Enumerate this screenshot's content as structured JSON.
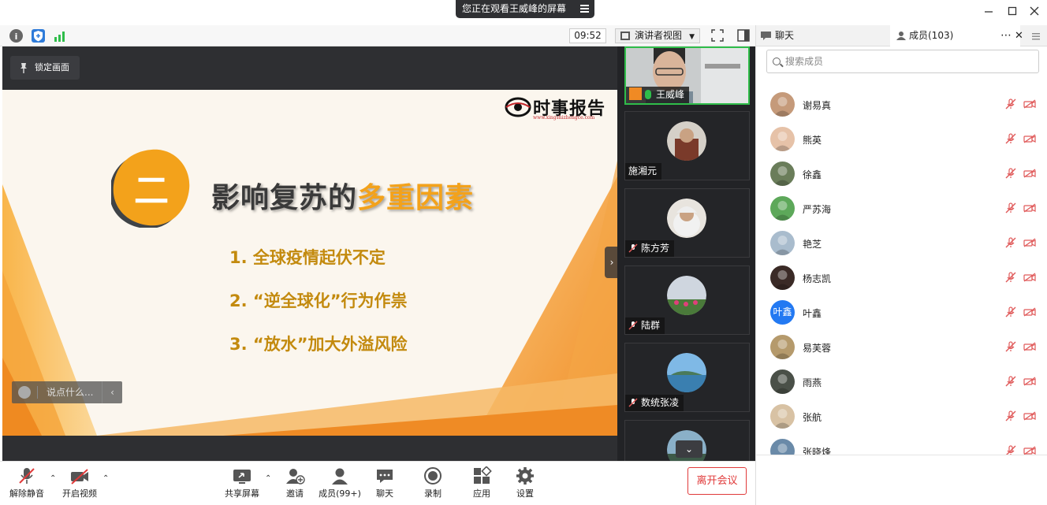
{
  "window": {
    "share_banner": "您正在观看王威峰的屏幕"
  },
  "toolbar": {
    "time": "09:52",
    "view_mode": "演讲者视图"
  },
  "stage": {
    "lock_label": "锁定画面",
    "chat_placeholder": "说点什么..."
  },
  "slide": {
    "logo_text": "时事报告",
    "logo_url": "www.xingshizhengce.com",
    "section_number": "二",
    "heading_prefix": "影响复苏的",
    "heading_highlight": "多重因素",
    "points": [
      "1.  全球疫情起伏不定",
      "2.  “逆全球化”行为作祟",
      "3.  “放水”加大外溢风险"
    ]
  },
  "video_tiles": [
    {
      "name": "王威峰"
    },
    {
      "name": "施湘元"
    },
    {
      "name": "陈方芳"
    },
    {
      "name": "陆群"
    },
    {
      "name": "数统张凌"
    }
  ],
  "bottom_bar": {
    "mute": "解除静音",
    "video": "开启视频",
    "share": "共享屏幕",
    "invite": "邀请",
    "members": "成员(99+)",
    "chat": "聊天",
    "record": "录制",
    "apps": "应用",
    "settings": "设置",
    "leave": "离开会议"
  },
  "panel": {
    "chat_tab": "聊天",
    "members_tab": "成员(103)",
    "search_placeholder": "搜索成员",
    "members": [
      {
        "name": "谢易真",
        "avatar": "photo",
        "color": "#c59a7a"
      },
      {
        "name": "熊英",
        "avatar": "photo",
        "color": "#e6c2a8"
      },
      {
        "name": "徐鑫",
        "avatar": "photo",
        "color": "#6a7d5a"
      },
      {
        "name": "严苏海",
        "avatar": "photo",
        "color": "#5da85a"
      },
      {
        "name": "艳芝",
        "avatar": "photo",
        "color": "#a9bccd"
      },
      {
        "name": "杨志凯",
        "avatar": "photo",
        "color": "#3a2a26"
      },
      {
        "name": "叶鑫",
        "avatar": "text",
        "initials": "叶鑫",
        "color": "#2379f2"
      },
      {
        "name": "易芙蓉",
        "avatar": "photo",
        "color": "#b59a6c"
      },
      {
        "name": "雨燕",
        "avatar": "photo",
        "color": "#4a5048"
      },
      {
        "name": "张航",
        "avatar": "photo",
        "color": "#d8c2a4"
      },
      {
        "name": "张晓烽",
        "avatar": "photo",
        "color": "#6a8aa8"
      }
    ]
  },
  "colors": {
    "accent_orange": "#f3a21b",
    "point_gold": "#c38a0e",
    "active_green": "#2fbd4a",
    "leave_red": "#e03a3a",
    "muted_red": "#e05a5a"
  }
}
